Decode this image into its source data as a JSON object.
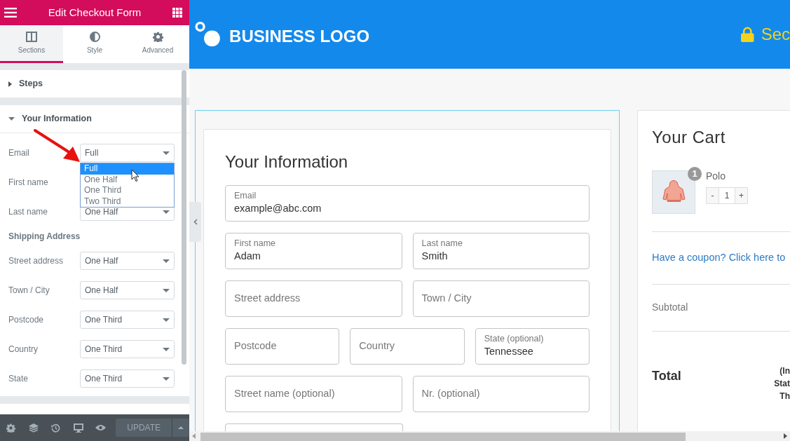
{
  "editor": {
    "title": "Edit Checkout Form",
    "tabs": [
      {
        "label": "Sections",
        "selected": true,
        "kind": "columns"
      },
      {
        "label": "Style",
        "selected": false,
        "kind": "contrast"
      },
      {
        "label": "Advanced",
        "selected": false,
        "kind": "gear"
      }
    ],
    "sections": [
      {
        "title": "Steps",
        "expanded": false
      },
      {
        "title": "Your Information",
        "expanded": true,
        "rows": [
          {
            "kind": "select",
            "label": "Email",
            "value": "Full"
          },
          {
            "kind": "covered",
            "label": "First name"
          },
          {
            "kind": "select",
            "label": "Last name",
            "value": "One Half"
          },
          {
            "kind": "heading",
            "label": "Shipping Address"
          },
          {
            "kind": "select",
            "label": "Street address",
            "value": "One Half"
          },
          {
            "kind": "select",
            "label": "Town / City",
            "value": "One Half"
          },
          {
            "kind": "select",
            "label": "Postcode",
            "value": "One Third"
          },
          {
            "kind": "select",
            "label": "Country",
            "value": "One Third"
          },
          {
            "kind": "select",
            "label": "State",
            "value": "One Third"
          }
        ]
      }
    ],
    "dropdown": {
      "options": [
        {
          "label": "Full",
          "selected": true
        },
        {
          "label": "One Half",
          "selected": false
        },
        {
          "label": "One Third",
          "selected": false
        },
        {
          "label": "Two Third",
          "selected": false
        }
      ]
    },
    "update_button": "UPDATE"
  },
  "site": {
    "logo_text": "BUSINESS LOGO",
    "secure_text": "Sec"
  },
  "form": {
    "title": "Your Information",
    "rows": [
      [
        {
          "kind": "field",
          "label": "Email",
          "value": "example@abc.com"
        }
      ],
      [
        {
          "kind": "field",
          "label": "First name",
          "value": "Adam"
        },
        {
          "kind": "field",
          "label": "Last name",
          "value": "Smith"
        }
      ],
      [
        {
          "kind": "field",
          "label": "Street address"
        },
        {
          "kind": "field",
          "label": "Town / City"
        }
      ],
      [
        {
          "kind": "field",
          "label": "Postcode"
        },
        {
          "kind": "field",
          "label": "Country"
        },
        {
          "kind": "field",
          "label": "State (optional)",
          "value": "Tennessee"
        }
      ],
      [
        {
          "kind": "field",
          "label": "Street name (optional)"
        },
        {
          "kind": "field",
          "label": "Nr. (optional)"
        }
      ],
      [
        {
          "kind": "cut"
        }
      ]
    ]
  },
  "cart": {
    "title": "Your Cart",
    "item": {
      "name": "Polo",
      "count": "1",
      "minus": "-",
      "quantity": "1",
      "plus": "+"
    },
    "coupon_link": "Have a coupon? Click here to",
    "subtotal_label": "Subtotal",
    "total_label": "Total",
    "total_note": [
      "(In",
      "Stat",
      "Th"
    ]
  }
}
